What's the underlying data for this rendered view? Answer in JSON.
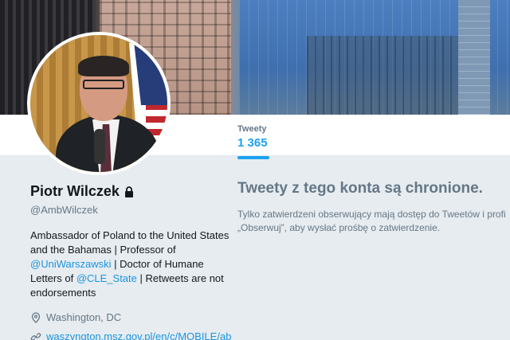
{
  "header": {
    "photo": "city-buildings-header-photo"
  },
  "stats": {
    "tweets_label": "Tweety",
    "tweets_count": "1 365"
  },
  "profile": {
    "name": "Piotr Wilczek",
    "handle": "@AmbWilczek",
    "bio": {
      "part1": "Ambassador of Poland to the United States and the Bahamas | Professor of ",
      "mention1": "@UniWarszawski",
      "part2": " | Doctor of Humane Letters of ",
      "mention2": "@CLE_State",
      "part3": " | Retweets are not endorsements"
    },
    "location": "Washington, DC",
    "website": "waszyngton.msz.gov.pl/en/c/MOBILE/ab",
    "icons": {
      "protected": "lock-icon",
      "location": "location-pin-icon",
      "website": "link-icon"
    }
  },
  "protected_notice": {
    "title": "Tweety z tego konta są chronione.",
    "line1": "Tylko zatwierdzeni obserwujący mają dostęp do Tweetów i profi",
    "line2": "„Obserwuj”, aby wysłać prośbę o zatwierdzenie."
  },
  "colors": {
    "accent": "#1da1f2",
    "background": "#e6ecf0",
    "muted": "#657786"
  }
}
